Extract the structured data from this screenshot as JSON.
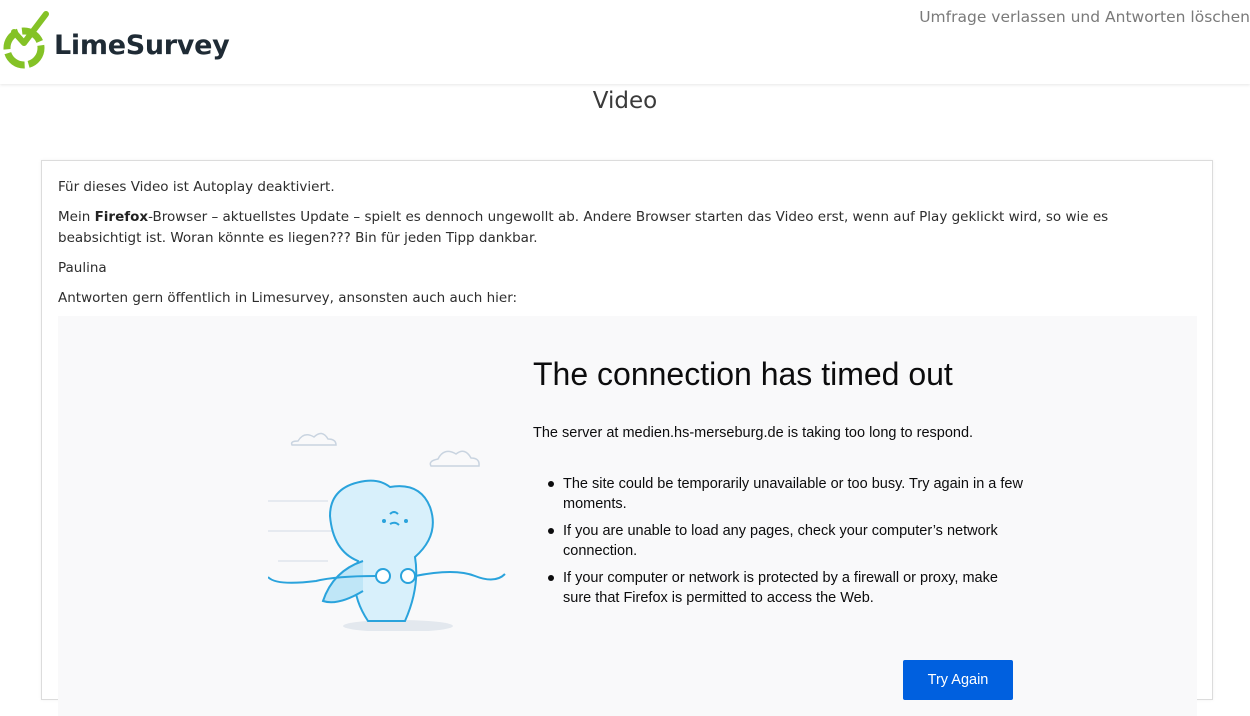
{
  "header": {
    "logo_text": "LimeSurvey",
    "exit_link": "Umfrage verlassen und Antworten löschen"
  },
  "group": {
    "title": "Video"
  },
  "question": {
    "line1": "Für dieses Video ist Autoplay deaktiviert.",
    "line2_prefix": "Mein ",
    "line2_bold": "Firefox",
    "line2_rest": "-Browser – aktuellstes Update – spielt es dennoch ungewollt ab. Andere Browser starten das Video erst, wenn auf Play geklickt wird, so wie es beabsichtigt ist. Woran könnte es liegen??? Bin für jeden Tipp dankbar.",
    "line3": "Paulina",
    "line4": "Antworten gern öffentlich in Limesurvey, ansonsten auch auch hier:"
  },
  "embed_error": {
    "title": "The connection has timed out",
    "description": "The server at medien.hs-merseburg.de is taking too long to respond.",
    "bullets": [
      "The site could be temporarily unavailable or too busy. Try again in a few moments.",
      "If you are unable to load any pages, check your computer’s network connection.",
      "If your computer or network is protected by a firewall or proxy, make sure that Firefox is permitted to access the Web."
    ],
    "button": "Try Again"
  },
  "colors": {
    "brand_green": "#84c226",
    "button_blue": "#0060df",
    "embed_bg": "#f9f9fa"
  }
}
